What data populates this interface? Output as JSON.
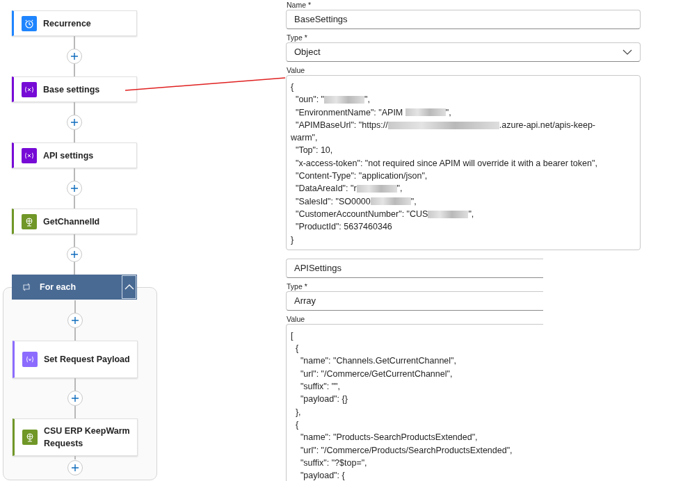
{
  "flow": {
    "steps": [
      {
        "kind": "clock",
        "label": "Recurrence",
        "color": "#1f85ff"
      },
      {
        "kind": "variable",
        "label": "Base settings",
        "color": "#770bd6"
      },
      {
        "kind": "variable",
        "label": "API settings",
        "color": "#770bd6"
      },
      {
        "kind": "web",
        "label": "GetChannelId",
        "color": "#709727"
      }
    ],
    "loop": {
      "label": "For each",
      "expanded": true,
      "children": [
        {
          "kind": "setvar",
          "label": "Set Request Payload",
          "color": "#8c6cff"
        },
        {
          "kind": "web",
          "label": "CSU ERP KeepWarm Requests",
          "color": "#709727"
        }
      ]
    }
  },
  "forms": [
    {
      "clipped": false,
      "name_label": "Name *",
      "name_value": "BaseSettings",
      "type_label": "Type *",
      "type_value": "Object",
      "value_label": "Value",
      "lines": [
        [
          {
            "kind": "text",
            "text": "{"
          }
        ],
        [
          {
            "kind": "text",
            "text": "  \"oun\": \""
          },
          {
            "kind": "redacted"
          },
          {
            "kind": "text",
            "text": "\","
          }
        ],
        [
          {
            "kind": "text",
            "text": "  \"EnvironmentName\": \"APIM "
          },
          {
            "kind": "redacted"
          },
          {
            "kind": "text",
            "text": "\","
          }
        ],
        [
          {
            "kind": "text",
            "text": "  \"APIMBaseUrl\": \"https://"
          },
          {
            "kind": "redacted_long"
          },
          {
            "kind": "text",
            "text": ".azure-api.net/apis-keep-"
          }
        ],
        [
          {
            "kind": "text",
            "text": "warm\","
          }
        ],
        [
          {
            "kind": "text",
            "text": "  \"Top\": 10,"
          }
        ],
        [
          {
            "kind": "text",
            "text": "  \"x-access-token\": \"not required since APIM will override it with a bearer token\","
          }
        ],
        [
          {
            "kind": "text",
            "text": "  \"Content-Type\": \"application/json\","
          }
        ],
        [
          {
            "kind": "text",
            "text": "  \"DataAreaId\": \"r"
          },
          {
            "kind": "redacted"
          },
          {
            "kind": "text",
            "text": "\","
          }
        ],
        [
          {
            "kind": "text",
            "text": "  \"SalesId\": \"SO0000"
          },
          {
            "kind": "redacted"
          },
          {
            "kind": "text",
            "text": "\","
          }
        ],
        [
          {
            "kind": "text",
            "text": "  \"CustomerAccountNumber\": \"CUS"
          },
          {
            "kind": "redacted"
          },
          {
            "kind": "text",
            "text": "\","
          }
        ],
        [
          {
            "kind": "text",
            "text": "  \"ProductId\": 5637460346"
          }
        ],
        [
          {
            "kind": "text",
            "text": "}"
          }
        ]
      ]
    },
    {
      "clipped": true,
      "name_value": "APISettings",
      "type_label": "Type *",
      "type_value": "Array",
      "value_label": "Value",
      "lines": [
        [
          {
            "kind": "text",
            "text": "["
          }
        ],
        [
          {
            "kind": "text",
            "text": "  {"
          }
        ],
        [
          {
            "kind": "text",
            "text": "    \"name\": \"Channels.GetCurrentChannel\","
          }
        ],
        [
          {
            "kind": "text",
            "text": "    \"url\": \"/Commerce/GetCurrentChannel\","
          }
        ],
        [
          {
            "kind": "text",
            "text": "    \"suffix\": \"\","
          }
        ],
        [
          {
            "kind": "text",
            "text": "    \"payload\": {}"
          }
        ],
        [
          {
            "kind": "text",
            "text": "  },"
          }
        ],
        [
          {
            "kind": "text",
            "text": "  {"
          }
        ],
        [
          {
            "kind": "text",
            "text": "    \"name\": \"Products-SearchProductsExtended\","
          }
        ],
        [
          {
            "kind": "text",
            "text": "    \"url\": \"/Commerce/Products/SearchProductsExtended\","
          }
        ],
        [
          {
            "kind": "text",
            "text": "    \"suffix\": \"?$top=\","
          }
        ],
        [
          {
            "kind": "text",
            "text": "    \"payload\": {"
          }
        ]
      ]
    }
  ]
}
